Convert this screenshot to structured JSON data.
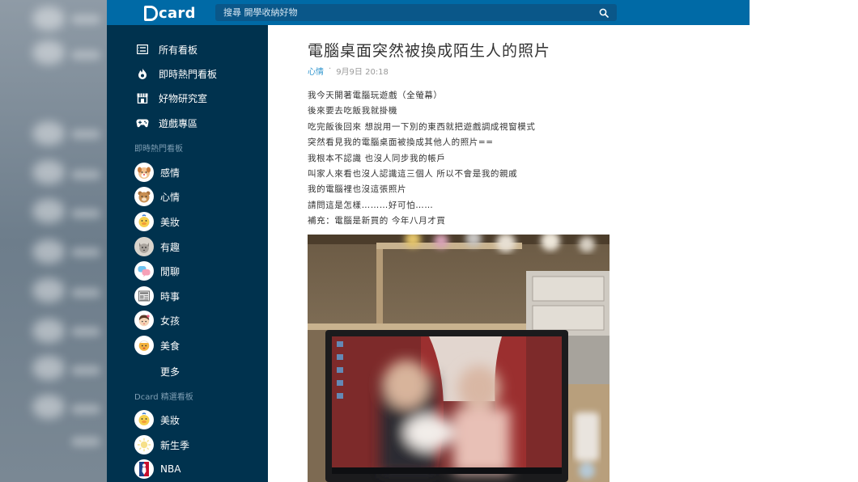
{
  "header": {
    "logo_text": "card",
    "search_placeholder": "搜尋 開學收納好物"
  },
  "sidebar": {
    "nav_items": [
      {
        "label": "所有看板",
        "icon": "board-list-icon"
      },
      {
        "label": "即時熱門看板",
        "icon": "fire-icon"
      },
      {
        "label": "好物研究室",
        "icon": "shop-icon"
      },
      {
        "label": "遊戲專區",
        "icon": "gamepad-icon"
      }
    ],
    "hot_section_label": "即時熱門看板",
    "hot_boards": [
      {
        "label": "感情",
        "icon": "dog-avatar-icon"
      },
      {
        "label": "心情",
        "icon": "bear-avatar-icon"
      },
      {
        "label": "美妝",
        "icon": "duck-avatar-icon"
      },
      {
        "label": "有趣",
        "icon": "cat-avatar-icon"
      },
      {
        "label": "閒聊",
        "icon": "chat-avatar-icon"
      },
      {
        "label": "時事",
        "icon": "newspaper-avatar-icon"
      },
      {
        "label": "女孩",
        "icon": "girl-avatar-icon"
      },
      {
        "label": "美食",
        "icon": "food-avatar-icon"
      }
    ],
    "more_label": "更多",
    "featured_section_label": "Dcard 精選看板",
    "featured_boards": [
      {
        "label": "美妝",
        "icon": "duck-avatar-icon"
      },
      {
        "label": "新生季",
        "icon": "sun-avatar-icon"
      },
      {
        "label": "NBA",
        "icon": "nba-logo-icon"
      }
    ]
  },
  "post": {
    "title": "電腦桌面突然被換成陌生人的照片",
    "board": "心情",
    "date": "9月9日 20:18",
    "lines": [
      "我今天開著電腦玩遊戲（全螢幕）",
      "後來要去吃飯我就掛機",
      "吃完飯後回來 想說用一下別的東西就把遊戲調成視窗模式",
      "突然看見我的電腦桌面被換成其他人的照片==",
      "我根本不認識 也沒人同步我的帳戶",
      "叫家人來看也沒人認識這三個人 所以不會是我的親戚",
      "我的電腦裡也沒這張照片",
      "請問這是怎樣………好可怕……",
      "補充：電腦是新買的 今年八月才買"
    ]
  },
  "colors": {
    "header_bg": "#006aa6",
    "sidebar_bg": "#00324e",
    "link_blue": "#3397cf"
  }
}
